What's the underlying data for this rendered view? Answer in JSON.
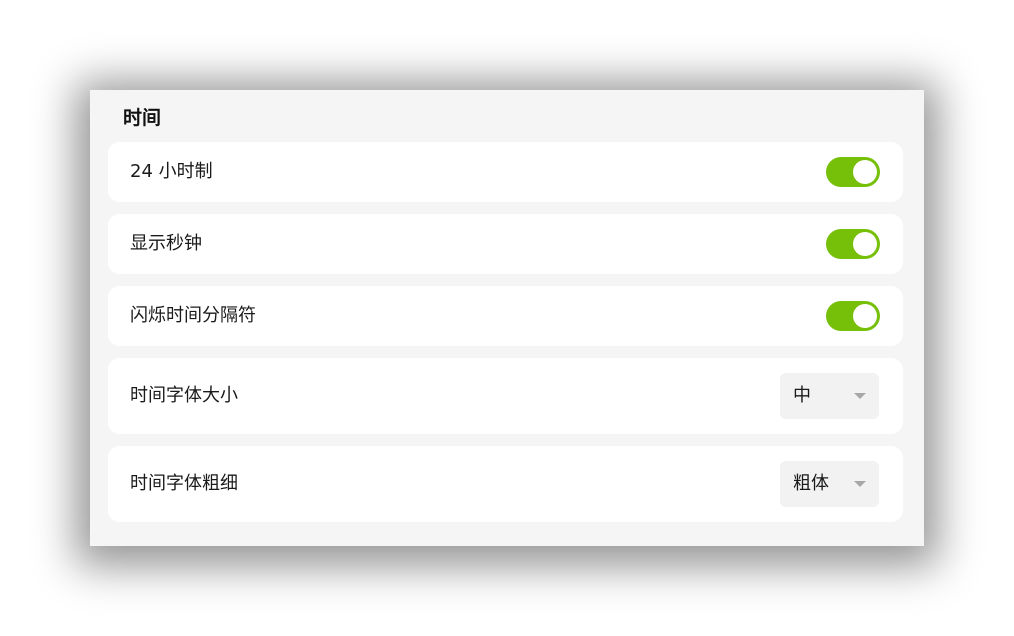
{
  "section": {
    "title": "时间"
  },
  "settings": [
    {
      "label": "24 小时制",
      "control": "toggle",
      "on": true
    },
    {
      "label": "显示秒钟",
      "control": "toggle",
      "on": true
    },
    {
      "label": "闪烁时间分隔符",
      "control": "toggle",
      "on": true
    },
    {
      "label": "时间字体大小",
      "control": "select",
      "value": "中"
    },
    {
      "label": "时间字体粗细",
      "control": "select",
      "value": "粗体"
    }
  ],
  "colors": {
    "accent": "#76c00a",
    "panel_bg": "#f5f5f5",
    "row_bg": "#ffffff",
    "select_bg": "#f2f2f2"
  },
  "icons": {
    "dropdown": "caret-down-icon"
  }
}
